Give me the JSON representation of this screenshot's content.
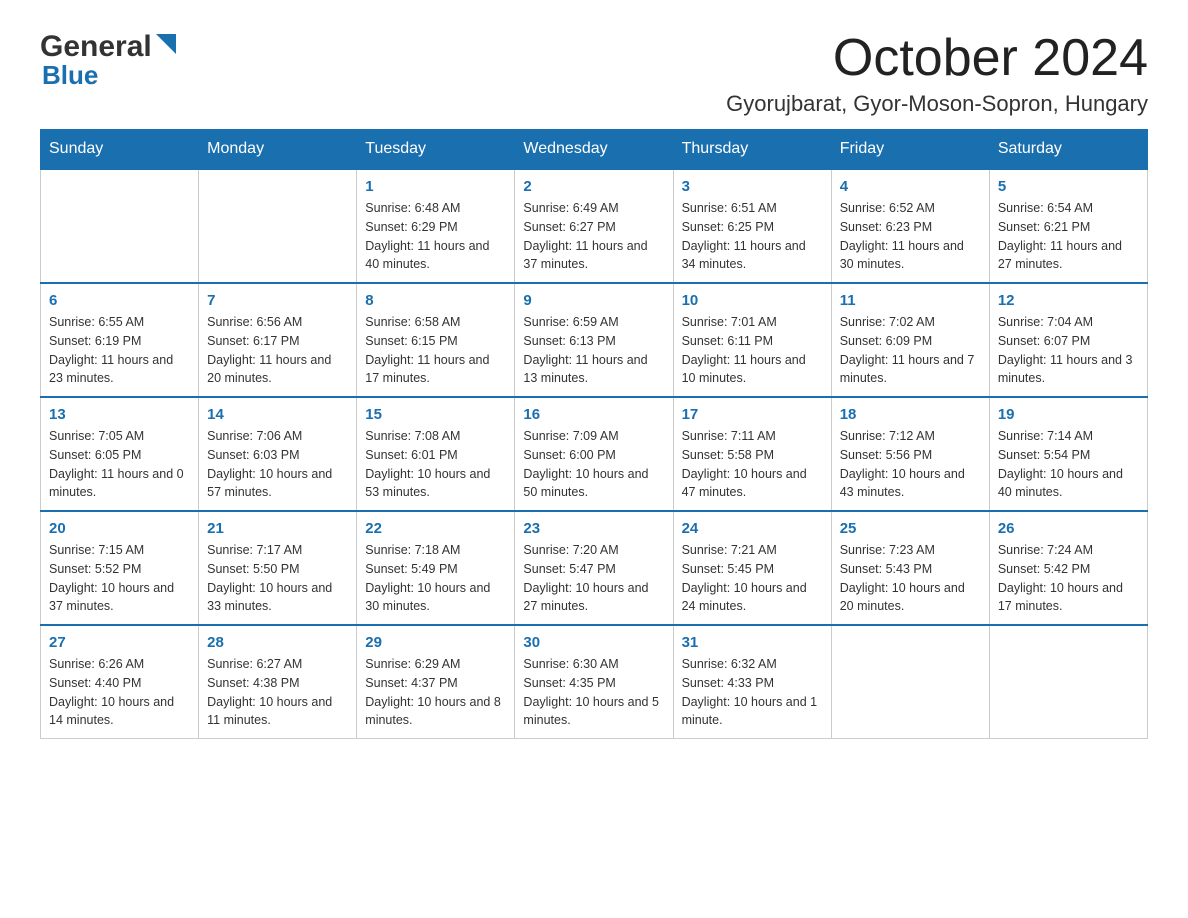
{
  "logo": {
    "general": "General",
    "blue": "Blue"
  },
  "title": "October 2024",
  "location": "Gyorujbarat, Gyor-Moson-Sopron, Hungary",
  "days": [
    "Sunday",
    "Monday",
    "Tuesday",
    "Wednesday",
    "Thursday",
    "Friday",
    "Saturday"
  ],
  "weeks": [
    [
      {
        "num": "",
        "sunrise": "",
        "sunset": "",
        "daylight": ""
      },
      {
        "num": "",
        "sunrise": "",
        "sunset": "",
        "daylight": ""
      },
      {
        "num": "1",
        "sunrise": "Sunrise: 6:48 AM",
        "sunset": "Sunset: 6:29 PM",
        "daylight": "Daylight: 11 hours and 40 minutes."
      },
      {
        "num": "2",
        "sunrise": "Sunrise: 6:49 AM",
        "sunset": "Sunset: 6:27 PM",
        "daylight": "Daylight: 11 hours and 37 minutes."
      },
      {
        "num": "3",
        "sunrise": "Sunrise: 6:51 AM",
        "sunset": "Sunset: 6:25 PM",
        "daylight": "Daylight: 11 hours and 34 minutes."
      },
      {
        "num": "4",
        "sunrise": "Sunrise: 6:52 AM",
        "sunset": "Sunset: 6:23 PM",
        "daylight": "Daylight: 11 hours and 30 minutes."
      },
      {
        "num": "5",
        "sunrise": "Sunrise: 6:54 AM",
        "sunset": "Sunset: 6:21 PM",
        "daylight": "Daylight: 11 hours and 27 minutes."
      }
    ],
    [
      {
        "num": "6",
        "sunrise": "Sunrise: 6:55 AM",
        "sunset": "Sunset: 6:19 PM",
        "daylight": "Daylight: 11 hours and 23 minutes."
      },
      {
        "num": "7",
        "sunrise": "Sunrise: 6:56 AM",
        "sunset": "Sunset: 6:17 PM",
        "daylight": "Daylight: 11 hours and 20 minutes."
      },
      {
        "num": "8",
        "sunrise": "Sunrise: 6:58 AM",
        "sunset": "Sunset: 6:15 PM",
        "daylight": "Daylight: 11 hours and 17 minutes."
      },
      {
        "num": "9",
        "sunrise": "Sunrise: 6:59 AM",
        "sunset": "Sunset: 6:13 PM",
        "daylight": "Daylight: 11 hours and 13 minutes."
      },
      {
        "num": "10",
        "sunrise": "Sunrise: 7:01 AM",
        "sunset": "Sunset: 6:11 PM",
        "daylight": "Daylight: 11 hours and 10 minutes."
      },
      {
        "num": "11",
        "sunrise": "Sunrise: 7:02 AM",
        "sunset": "Sunset: 6:09 PM",
        "daylight": "Daylight: 11 hours and 7 minutes."
      },
      {
        "num": "12",
        "sunrise": "Sunrise: 7:04 AM",
        "sunset": "Sunset: 6:07 PM",
        "daylight": "Daylight: 11 hours and 3 minutes."
      }
    ],
    [
      {
        "num": "13",
        "sunrise": "Sunrise: 7:05 AM",
        "sunset": "Sunset: 6:05 PM",
        "daylight": "Daylight: 11 hours and 0 minutes."
      },
      {
        "num": "14",
        "sunrise": "Sunrise: 7:06 AM",
        "sunset": "Sunset: 6:03 PM",
        "daylight": "Daylight: 10 hours and 57 minutes."
      },
      {
        "num": "15",
        "sunrise": "Sunrise: 7:08 AM",
        "sunset": "Sunset: 6:01 PM",
        "daylight": "Daylight: 10 hours and 53 minutes."
      },
      {
        "num": "16",
        "sunrise": "Sunrise: 7:09 AM",
        "sunset": "Sunset: 6:00 PM",
        "daylight": "Daylight: 10 hours and 50 minutes."
      },
      {
        "num": "17",
        "sunrise": "Sunrise: 7:11 AM",
        "sunset": "Sunset: 5:58 PM",
        "daylight": "Daylight: 10 hours and 47 minutes."
      },
      {
        "num": "18",
        "sunrise": "Sunrise: 7:12 AM",
        "sunset": "Sunset: 5:56 PM",
        "daylight": "Daylight: 10 hours and 43 minutes."
      },
      {
        "num": "19",
        "sunrise": "Sunrise: 7:14 AM",
        "sunset": "Sunset: 5:54 PM",
        "daylight": "Daylight: 10 hours and 40 minutes."
      }
    ],
    [
      {
        "num": "20",
        "sunrise": "Sunrise: 7:15 AM",
        "sunset": "Sunset: 5:52 PM",
        "daylight": "Daylight: 10 hours and 37 minutes."
      },
      {
        "num": "21",
        "sunrise": "Sunrise: 7:17 AM",
        "sunset": "Sunset: 5:50 PM",
        "daylight": "Daylight: 10 hours and 33 minutes."
      },
      {
        "num": "22",
        "sunrise": "Sunrise: 7:18 AM",
        "sunset": "Sunset: 5:49 PM",
        "daylight": "Daylight: 10 hours and 30 minutes."
      },
      {
        "num": "23",
        "sunrise": "Sunrise: 7:20 AM",
        "sunset": "Sunset: 5:47 PM",
        "daylight": "Daylight: 10 hours and 27 minutes."
      },
      {
        "num": "24",
        "sunrise": "Sunrise: 7:21 AM",
        "sunset": "Sunset: 5:45 PM",
        "daylight": "Daylight: 10 hours and 24 minutes."
      },
      {
        "num": "25",
        "sunrise": "Sunrise: 7:23 AM",
        "sunset": "Sunset: 5:43 PM",
        "daylight": "Daylight: 10 hours and 20 minutes."
      },
      {
        "num": "26",
        "sunrise": "Sunrise: 7:24 AM",
        "sunset": "Sunset: 5:42 PM",
        "daylight": "Daylight: 10 hours and 17 minutes."
      }
    ],
    [
      {
        "num": "27",
        "sunrise": "Sunrise: 6:26 AM",
        "sunset": "Sunset: 4:40 PM",
        "daylight": "Daylight: 10 hours and 14 minutes."
      },
      {
        "num": "28",
        "sunrise": "Sunrise: 6:27 AM",
        "sunset": "Sunset: 4:38 PM",
        "daylight": "Daylight: 10 hours and 11 minutes."
      },
      {
        "num": "29",
        "sunrise": "Sunrise: 6:29 AM",
        "sunset": "Sunset: 4:37 PM",
        "daylight": "Daylight: 10 hours and 8 minutes."
      },
      {
        "num": "30",
        "sunrise": "Sunrise: 6:30 AM",
        "sunset": "Sunset: 4:35 PM",
        "daylight": "Daylight: 10 hours and 5 minutes."
      },
      {
        "num": "31",
        "sunrise": "Sunrise: 6:32 AM",
        "sunset": "Sunset: 4:33 PM",
        "daylight": "Daylight: 10 hours and 1 minute."
      },
      {
        "num": "",
        "sunrise": "",
        "sunset": "",
        "daylight": ""
      },
      {
        "num": "",
        "sunrise": "",
        "sunset": "",
        "daylight": ""
      }
    ]
  ]
}
